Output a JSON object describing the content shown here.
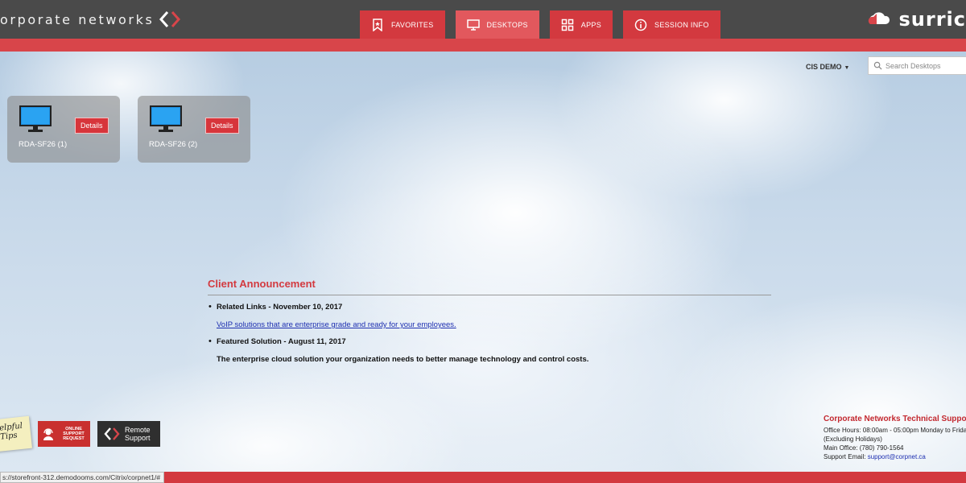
{
  "header": {
    "logo_text": "orporate networks",
    "brand_text": "surric",
    "tabs": [
      {
        "label": "FAVORITES",
        "icon": "bookmark-icon",
        "active": false
      },
      {
        "label": "DESKTOPS",
        "icon": "monitor-icon",
        "active": true
      },
      {
        "label": "APPS",
        "icon": "grid-icon",
        "active": false
      },
      {
        "label": "SESSION INFO",
        "icon": "info-icon",
        "active": false
      }
    ]
  },
  "toolbar": {
    "store_label": "CIS DEMO",
    "search_placeholder": "Search Desktops"
  },
  "desktops": [
    {
      "name": "RDA-SF26 (1)",
      "details_label": "Details"
    },
    {
      "name": "RDA-SF26 (2)",
      "details_label": "Details"
    }
  ],
  "announcement": {
    "title": "Client Announcement",
    "items": [
      {
        "heading": "Related Links - November 10, 2017",
        "link_text": "VoIP solutions that are enterprise grade and ready for your employees."
      },
      {
        "heading": "Featured Solution - August 11, 2017",
        "body": "The enterprise cloud solution your organization needs to better manage technology and control costs."
      }
    ]
  },
  "widgets": {
    "tips_line1": "elpful",
    "tips_line2": "Tips",
    "online_support": "ONLINE SUPPORT REQUEST",
    "remote_support_line1": "Remote",
    "remote_support_line2": "Support"
  },
  "support": {
    "title": "Corporate Networks Technical Support",
    "hours": "Office Hours: 08:00am - 05:00pm Monday to Frida",
    "holidays": "(Excluding Holidays)",
    "main_office": "Main Office: (780) 790-1564",
    "email_label": "Support Email: ",
    "email": "support@corpnet.ca"
  },
  "status_bar": {
    "url": "s://storefront-312.demodooms.com/Citrix/corpnet1/#"
  },
  "colors": {
    "accent_red": "#d3393f",
    "header_gray": "#4a4a4a",
    "link_blue": "#1d2fb0"
  }
}
